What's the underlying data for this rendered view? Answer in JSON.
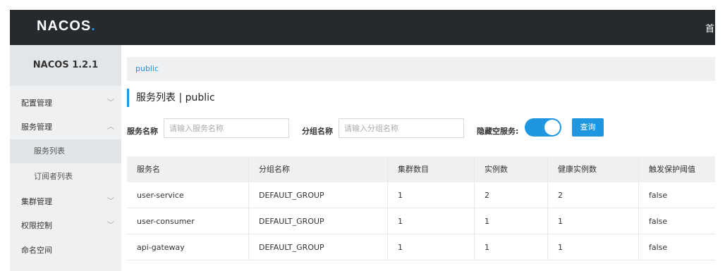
{
  "header": {
    "logo_prefix": "NAC",
    "logo_mid": "O",
    "logo_suffix": "S",
    "logo_dot": ".",
    "nav_first": "首页"
  },
  "sidebar": {
    "title": "NACOS 1.2.1",
    "items": [
      {
        "label": "配置管理",
        "arrow": "﹀"
      },
      {
        "label": "服务管理",
        "arrow": "︿"
      },
      {
        "label": "服务列表"
      },
      {
        "label": "订阅者列表"
      },
      {
        "label": "集群管理",
        "arrow": "﹀"
      },
      {
        "label": "权限控制",
        "arrow": "﹀"
      },
      {
        "label": "命名空间"
      }
    ]
  },
  "breadcrumb": {
    "namespace": "public"
  },
  "page": {
    "title": "服务列表  |  public"
  },
  "filters": {
    "service_label": "服务名称",
    "service_placeholder": "请输入服务名称",
    "group_label": "分组名称",
    "group_placeholder": "请输入分组名称",
    "hide_empty_label": "隐藏空服务:",
    "hide_empty_on": true,
    "query_button": "查询"
  },
  "table": {
    "columns": [
      "服务名",
      "分组名称",
      "集群数目",
      "实例数",
      "健康实例数",
      "触发保护阈值"
    ],
    "rows": [
      [
        "user-service",
        "DEFAULT_GROUP",
        "1",
        "2",
        "2",
        "false"
      ],
      [
        "user-consumer",
        "DEFAULT_GROUP",
        "1",
        "1",
        "1",
        "false"
      ],
      [
        "api-gateway",
        "DEFAULT_GROUP",
        "1",
        "1",
        "1",
        "false"
      ]
    ]
  },
  "colors": {
    "accent": "#1f96e0",
    "topbar": "#252a2f",
    "sidebar": "#eef0f1"
  }
}
